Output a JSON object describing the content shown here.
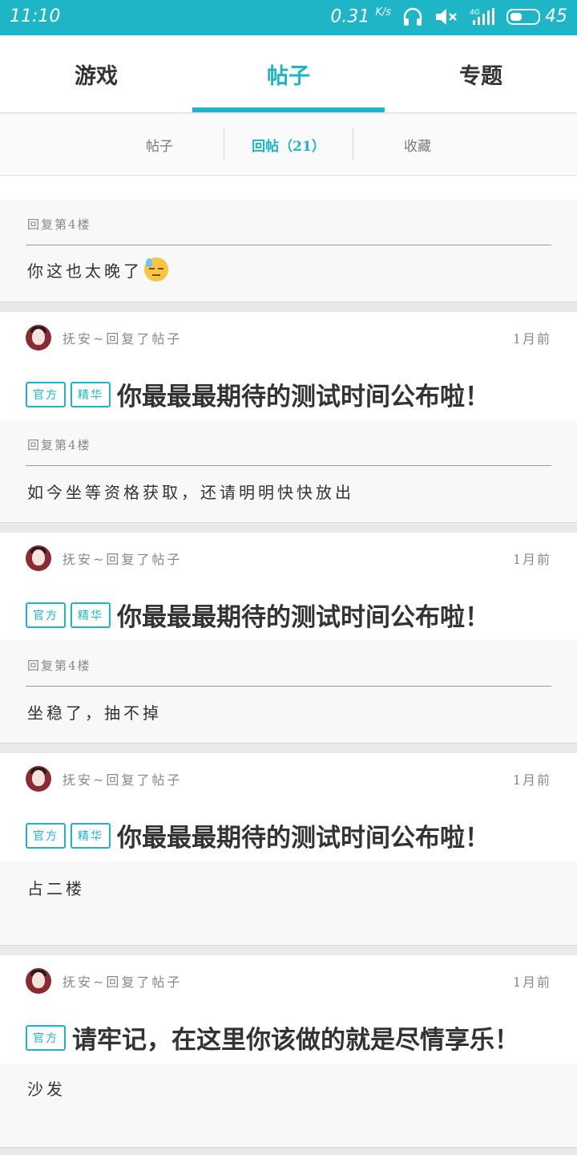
{
  "status": {
    "time": "11:10",
    "speed": "0.31",
    "speed_unit": "K/s",
    "network": "4G",
    "battery": "45",
    "battery_level": 0.45
  },
  "tabs": [
    {
      "label": "游戏"
    },
    {
      "label": "帖子"
    },
    {
      "label": "专题"
    }
  ],
  "subtabs": [
    {
      "label": "帖子"
    },
    {
      "label": "回帖（21）"
    },
    {
      "label": "收藏"
    }
  ],
  "partial_card": {
    "quote": "回复第4楼",
    "reply": "你这也太晚了"
  },
  "cards": [
    {
      "user_action": "抚安~回复了帖子",
      "when": "1月前",
      "badges": [
        "官方",
        "精华"
      ],
      "title": "你最最最期待的测试时间公布啦！",
      "quote": "回复第4楼",
      "reply": "如今坐等资格获取，还请明明快快放出"
    },
    {
      "user_action": "抚安~回复了帖子",
      "when": "1月前",
      "badges": [
        "官方",
        "精华"
      ],
      "title": "你最最最期待的测试时间公布啦！",
      "quote": "回复第4楼",
      "reply": "坐稳了，抽不掉"
    },
    {
      "user_action": "抚安~回复了帖子",
      "when": "1月前",
      "badges": [
        "官方",
        "精华"
      ],
      "title": "你最最最期待的测试时间公布啦！",
      "quote": "",
      "reply": "占二楼"
    },
    {
      "user_action": "抚安~回复了帖子",
      "when": "1月前",
      "badges": [
        "官方"
      ],
      "title": "请牢记，在这里你该做的就是尽情享乐！",
      "quote": "",
      "reply": "沙发"
    }
  ]
}
